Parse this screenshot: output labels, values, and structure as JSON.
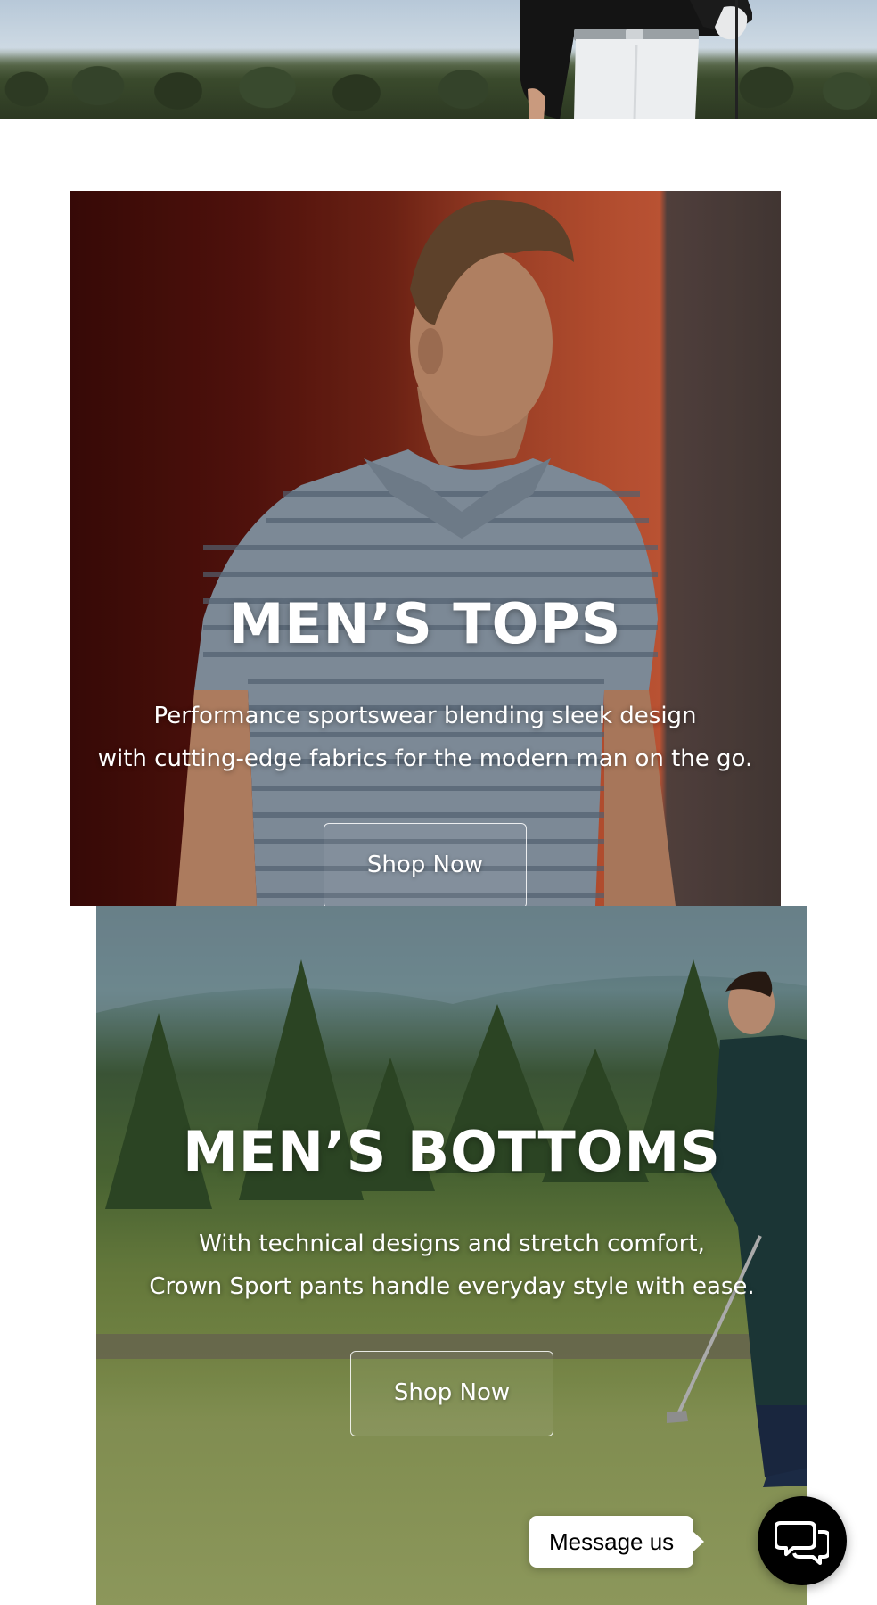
{
  "hero": {
    "image_alt": "Golfer in black top and white pants holding a club"
  },
  "cards": [
    {
      "title": "MEN’S TOPS",
      "description_lines": [
        "Performance sportswear blending sleek design",
        "with cutting-edge fabrics for the modern man on the go."
      ],
      "button_label": "Shop Now"
    },
    {
      "title": "MEN’S BOTTOMS",
      "description_lines": [
        "With technical designs and stretch comfort,",
        "Crown Sport pants handle everyday style with ease."
      ],
      "button_label": "Shop Now"
    }
  ],
  "chat": {
    "label": "Message us",
    "icon": "chat-bubbles-icon"
  },
  "colors": {
    "chat_button_bg": "#000000",
    "text_on_image": "#ffffff"
  }
}
